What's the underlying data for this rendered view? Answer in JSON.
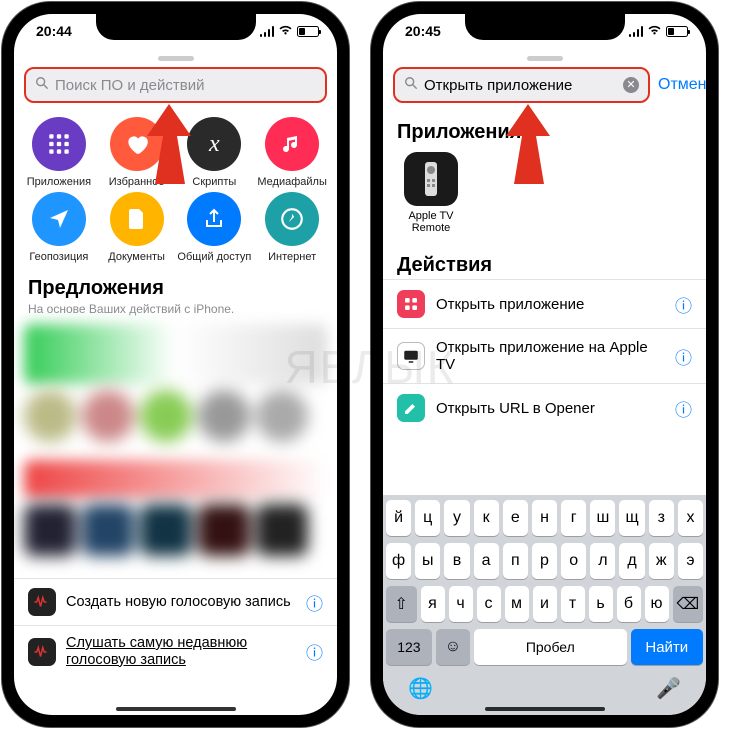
{
  "watermark": "ЯБЛЫК",
  "left": {
    "time": "20:44",
    "search_placeholder": "Поиск ПО и действий",
    "categories": [
      {
        "label": "Приложения",
        "color": "#6a3cc4",
        "icon": "grid"
      },
      {
        "label": "Избранное",
        "color": "#ff5a3c",
        "icon": "heart"
      },
      {
        "label": "Скрипты",
        "color": "#2a2a2a",
        "icon": "x"
      },
      {
        "label": "Медиафайлы",
        "color": "#ff2d55",
        "icon": "music"
      },
      {
        "label": "Геопозиция",
        "color": "#1e95ff",
        "icon": "nav"
      },
      {
        "label": "Документы",
        "color": "#ffb500",
        "icon": "doc"
      },
      {
        "label": "Общий доступ",
        "color": "#007aff",
        "icon": "share"
      },
      {
        "label": "Интернет",
        "color": "#1da0a6",
        "icon": "compass"
      }
    ],
    "sugg_title": "Предложения",
    "sugg_sub": "На основе Ваших действий с iPhone.",
    "suggestions": [
      {
        "text": "Создать новую голосовую запись"
      },
      {
        "text": "Слушать самую недавнюю голосовую запись"
      }
    ]
  },
  "right": {
    "time": "20:45",
    "search_value": "Открыть приложение",
    "cancel": "Отменить",
    "apps_title": "Приложения",
    "app": {
      "name": "Apple TV Remote"
    },
    "actions_title": "Действия",
    "actions": [
      {
        "text": "Открыть приложение",
        "color": "#ef3e5b",
        "icon": "grid"
      },
      {
        "text": "Открыть приложение на Apple TV",
        "color": "#222",
        "icon": "tv"
      },
      {
        "text": "Открыть URL в Opener",
        "color": "#22c0a8",
        "icon": "pencil"
      }
    ],
    "keys_r1": [
      "й",
      "ц",
      "у",
      "к",
      "е",
      "н",
      "г",
      "ш",
      "щ",
      "з",
      "х"
    ],
    "keys_r2": [
      "ф",
      "ы",
      "в",
      "а",
      "п",
      "р",
      "о",
      "л",
      "д",
      "ж",
      "э"
    ],
    "keys_r3": [
      "я",
      "ч",
      "с",
      "м",
      "и",
      "т",
      "ь",
      "б",
      "ю"
    ],
    "key_num": "123",
    "key_space": "Пробел",
    "key_find": "Найти"
  }
}
